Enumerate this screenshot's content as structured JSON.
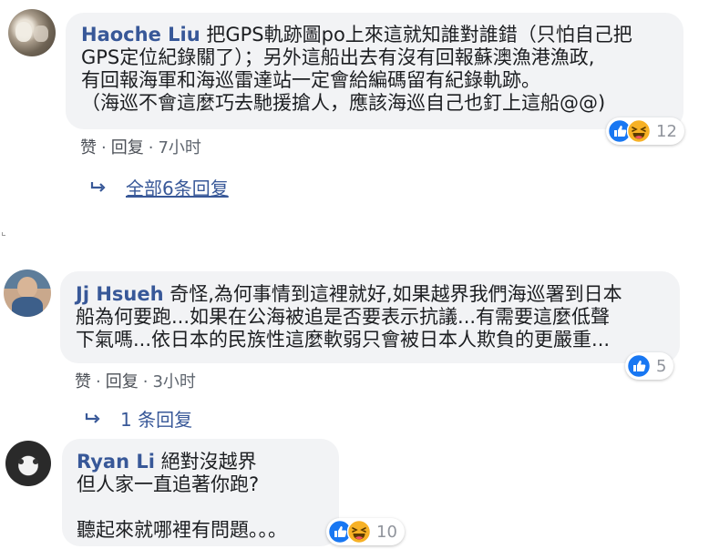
{
  "comments": [
    {
      "author": "Haoche Liu",
      "lines": [
        "把GPS軌跡圖po上來這就知誰對誰錯（只怕自己把",
        "GPS定位紀錄關了）；另外這船出去有沒有回報蘇澳漁港漁政,",
        "有回報海軍和海巡雷達站一定會給編碼留有紀錄軌跡。",
        "（海巡不會這麼巧去馳援搶人，應該海巡自己也釘上這船@@)"
      ],
      "like_label": "赞",
      "reply_label": "回复",
      "time": "7小时",
      "reaction_count": "12",
      "reactions": [
        "like",
        "haha"
      ],
      "replies_label": "全部6条回复"
    },
    {
      "author": "Jj Hsueh",
      "lines": [
        "奇怪,為何事情到這裡就好,如果越界我們海巡署到日本",
        "船為何要跑...如果在公海被追是否要表示抗議...有需要這麼低聲",
        "下氣嗎...依日本的民族性這麼軟弱只會被日本人欺負的更嚴重..."
      ],
      "like_label": "赞",
      "reply_label": "回复",
      "time": "3小时",
      "reaction_count": "5",
      "reactions": [
        "like"
      ],
      "replies_label": "1 条回复"
    },
    {
      "author": "Ryan Li",
      "lines": [
        "絕對沒越界",
        "但人家一直追著你跑?",
        "",
        "聽起來就哪裡有問題。。。"
      ],
      "reaction_count": "10",
      "reactions": [
        "like",
        "haha"
      ]
    }
  ],
  "colors": {
    "author": "#385898",
    "bubble": "#f2f3f5",
    "like": "#1877f2",
    "haha": "#f7b125"
  },
  "icons": {
    "reply_arrow": "reply-arrow-icon",
    "like": "like-reaction-icon",
    "haha": "haha-reaction-icon"
  }
}
